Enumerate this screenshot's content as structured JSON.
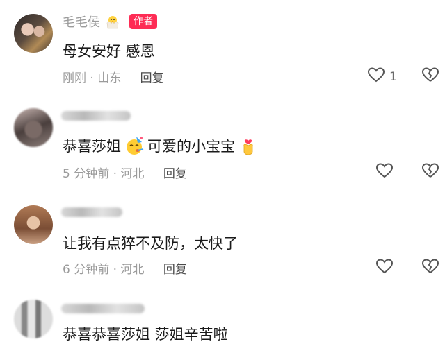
{
  "comments": [
    {
      "username": "毛毛侯",
      "author_badge": "作者",
      "text": "母女安好 感恩",
      "meta": "刚刚 · 山东",
      "reply": "回复",
      "likes": "1"
    },
    {
      "username": "",
      "text_before_emoji": "恭喜莎姐",
      "text_after_emoji": "可爱的小宝宝",
      "meta": "5 分钟前 · 河北",
      "reply": "回复",
      "likes": ""
    },
    {
      "username": "",
      "text": "让我有点猝不及防，太快了",
      "meta": "6 分钟前 · 河北",
      "reply": "回复",
      "likes": ""
    },
    {
      "username": "",
      "text_partial": "恭喜恭喜莎姐  莎姐辛苦啦"
    }
  ],
  "icons": {
    "like": "heart-outline-icon",
    "dislike": "broken-heart-icon",
    "party": "party-face-emoji",
    "heart_hand": "finger-heart-emoji",
    "chick": "hatching-chick-emoji"
  },
  "colors": {
    "author_badge": "#fe2c55",
    "meta_text": "#9b9b9b",
    "body_text": "#1a1a1a"
  }
}
